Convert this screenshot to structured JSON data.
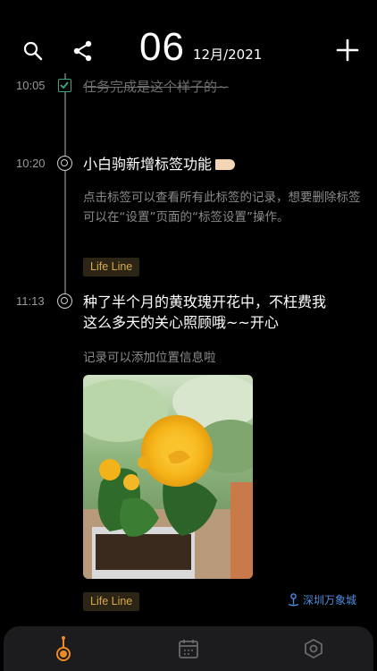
{
  "header": {
    "day": "06",
    "month_year": "12月/2021",
    "icons": [
      "search-icon",
      "share-icon",
      "add-icon"
    ]
  },
  "entries": [
    {
      "time": "10:05",
      "title": "任务完成是这个样子的~",
      "status": "done"
    },
    {
      "time": "10:20",
      "title": "小白驹新增标签功能",
      "body": "点击标签可以查看所有此标签的记录，想要删除标签可以在“设置”页面的“标签设置”操作。",
      "tag": "Life Line"
    },
    {
      "time": "11:13",
      "title_line1": "种了半个月的黄玫瑰开花中，不枉费我",
      "title_line2": "这么多天的关心照顾哦~~开心",
      "body": "记录可以添加位置信息啦",
      "tag": "Life Line",
      "location": "深圳万象城"
    }
  ],
  "tabbar": {
    "tabs": [
      "timeline-tab",
      "calendar-tab",
      "settings-tab"
    ],
    "active": "timeline-tab"
  },
  "colors": {
    "background": "#000000",
    "tag_text": "#d9a944",
    "tag_bg": "#2c2414",
    "checkbox": "#3aa58a",
    "location": "#4a8fe0",
    "active_tab": "#f08a24"
  }
}
